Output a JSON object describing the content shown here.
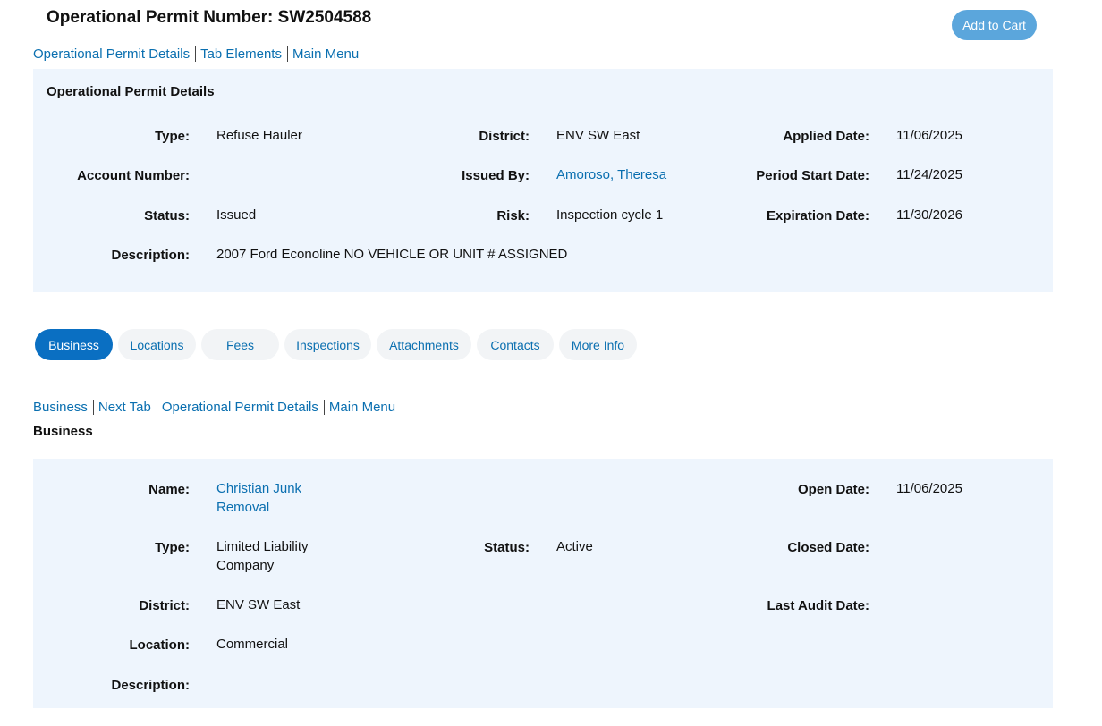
{
  "header": {
    "title": "Operational Permit Number: SW2504588",
    "cart_label": "Add to Cart"
  },
  "top_links": [
    "Operational Permit Details",
    "Tab Elements",
    "Main Menu"
  ],
  "permit": {
    "section_title": "Operational Permit Details",
    "type_label": "Type:",
    "type_value": "Refuse Hauler",
    "district_label": "District:",
    "district_value": "ENV SW East",
    "applied_label": "Applied Date:",
    "applied_value": "11/06/2025",
    "account_label": "Account Number:",
    "account_value": "",
    "issued_by_label": "Issued By:",
    "issued_by_value": "Amoroso, Theresa",
    "period_start_label": "Period Start Date:",
    "period_start_value": "11/24/2025",
    "status_label": "Status:",
    "status_value": "Issued",
    "risk_label": "Risk:",
    "risk_value": "Inspection cycle 1",
    "expiration_label": "Expiration Date:",
    "expiration_value": "11/30/2026",
    "description_label": "Description:",
    "description_value": "2007 Ford Econoline NO VEHICLE OR UNIT # ASSIGNED"
  },
  "tabs": [
    {
      "label": "Business",
      "active": true
    },
    {
      "label": "Locations",
      "active": false
    },
    {
      "label": "Fees",
      "active": false
    },
    {
      "label": "Inspections",
      "active": false
    },
    {
      "label": "Attachments",
      "active": false
    },
    {
      "label": "Contacts",
      "active": false
    },
    {
      "label": "More Info",
      "active": false
    }
  ],
  "tab_links": [
    "Business",
    "Next Tab",
    "Operational Permit Details",
    "Main Menu"
  ],
  "business": {
    "section_title": "Business",
    "name_label": "Name:",
    "name_value": "Christian Junk Removal",
    "open_date_label": "Open Date:",
    "open_date_value": "11/06/2025",
    "type_label": "Type:",
    "type_value": "Limited Liability Company",
    "status_label": "Status:",
    "status_value": "Active",
    "closed_date_label": "Closed Date:",
    "closed_date_value": "",
    "district_label": "District:",
    "district_value": "ENV SW East",
    "last_audit_label": "Last Audit Date:",
    "last_audit_value": "",
    "location_label": "Location:",
    "location_value": "Commercial",
    "description_label": "Description:",
    "description_value": ""
  },
  "colors": {
    "link": "#0a6fb0",
    "panel_bg": "#eef5fd",
    "active_tab": "#0a6fc2",
    "cart_button": "#5ba6dc"
  }
}
